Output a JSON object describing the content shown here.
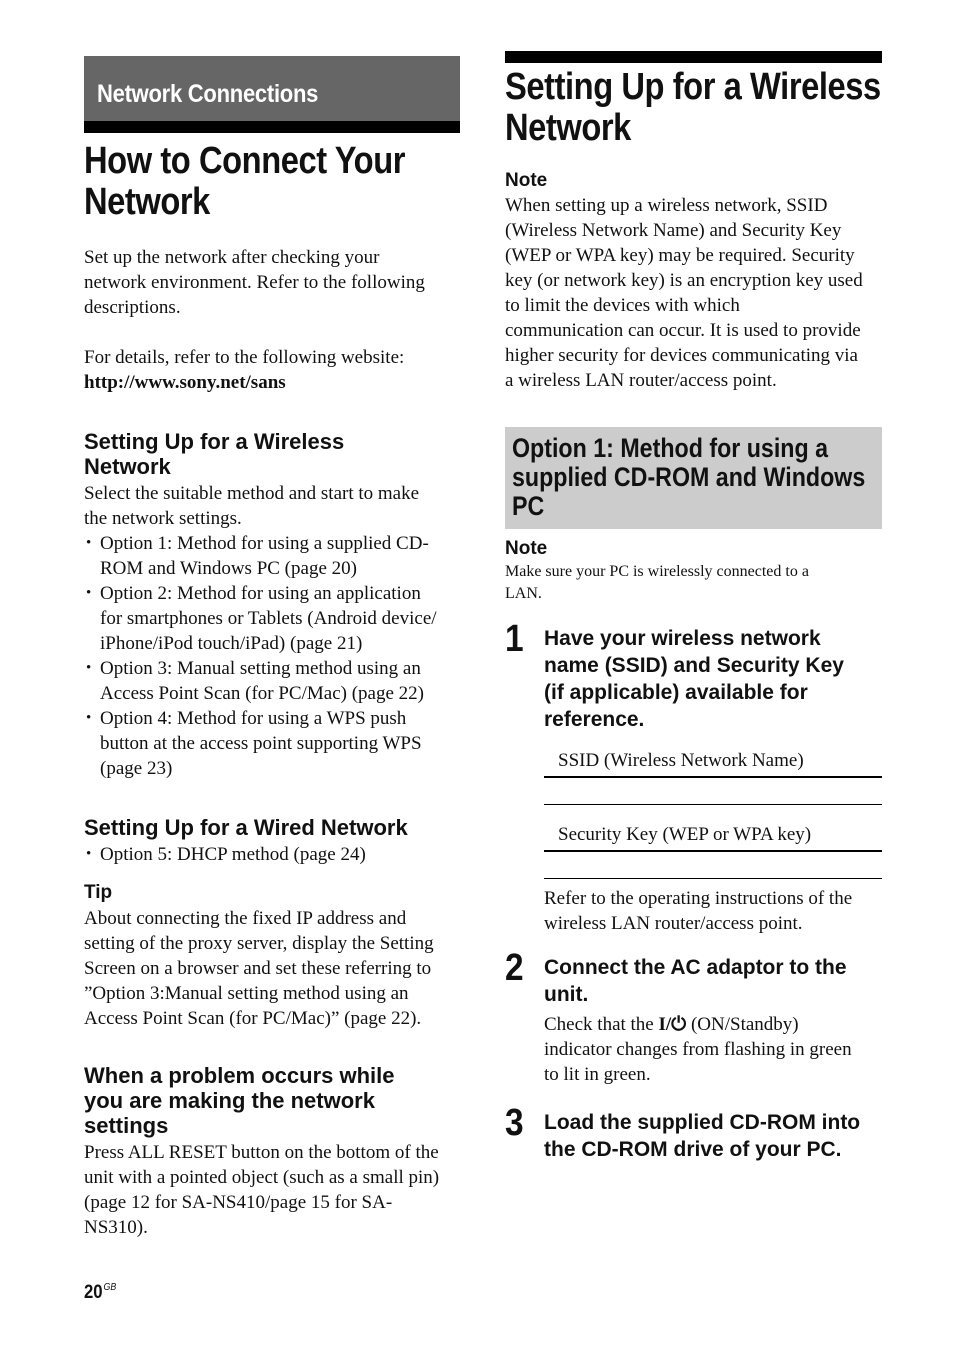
{
  "left": {
    "section_label": "Network Connections",
    "title_lines": [
      "How to Connect Your",
      "Network"
    ],
    "intro": [
      "Set up the network after checking your",
      "network environment. Refer to the following",
      "descriptions."
    ],
    "details_text": "For details, refer to the following website:",
    "website_link": "http://www.sony.net/sans",
    "wireless": {
      "heading_lines": [
        "Setting Up for a Wireless",
        "Network"
      ],
      "intro_lines": [
        "Select the suitable method and start to make",
        "the network settings."
      ],
      "options": [
        {
          "lines": [
            "Option 1: Method for using a supplied CD-",
            "ROM and Windows PC (page 20)"
          ]
        },
        {
          "lines": [
            "Option 2: Method for using an application",
            "for smartphones or Tablets (Android device/",
            "iPhone/iPod touch/iPad) (page 21)"
          ]
        },
        {
          "lines": [
            "Option 3: Manual setting method using an",
            "Access Point Scan (for PC/Mac) (page 22)"
          ]
        },
        {
          "lines": [
            "Option 4: Method for using a WPS push",
            "button at the access point supporting WPS",
            "(page 23)"
          ]
        }
      ]
    },
    "wired": {
      "heading": "Setting Up for a Wired Network",
      "options": [
        "Option 5: DHCP method (page 24)"
      ]
    },
    "tip": {
      "label": "Tip",
      "lines": [
        "About connecting the fixed IP address and",
        "setting of the proxy server, display the Setting",
        "Screen on a browser and set these referring to",
        "”Option 3:Manual setting method using an",
        "Access Point Scan (for PC/Mac)” (page 22)."
      ]
    },
    "problem": {
      "heading_lines": [
        "When a problem occurs while",
        "you are making the network",
        "settings"
      ],
      "lines": [
        "Press ALL RESET button on the bottom of the",
        "unit with a pointed object (such as a small pin)",
        "(page 12 for SA-NS410/page 15 for SA-",
        "NS310)."
      ]
    }
  },
  "right": {
    "title_lines": [
      "Setting Up for a Wireless",
      "Network"
    ],
    "note": {
      "label": "Note",
      "lines": [
        "When setting up a wireless network, SSID",
        "(Wireless Network Name) and Security Key",
        "(WEP or WPA key) may be required. Security",
        "key (or network key) is an encryption key used",
        "to limit the devices with which",
        "communication can occur. It is used to provide",
        "higher security for devices communicating via",
        "a wireless LAN router/access point."
      ]
    },
    "option_box_lines": [
      "Option 1: Method for using a",
      "supplied CD-ROM and Windows",
      "PC"
    ],
    "note2": {
      "label": "Note",
      "lines": [
        "Make sure your PC is wirelessly connected to a",
        "LAN."
      ]
    },
    "steps": [
      {
        "number": "1",
        "title_lines": [
          "Have your wireless network",
          "name (SSID) and Security Key",
          "(if applicable) available for",
          "reference."
        ],
        "fields": [
          {
            "label": "SSID (Wireless Network Name)",
            "value": ""
          },
          {
            "label": "Security Key (WEP or WPA key)",
            "value": ""
          }
        ],
        "body_lines": [
          "Refer to the operating instructions of the",
          "wireless LAN router/access point."
        ]
      },
      {
        "number": "2",
        "title_lines": [
          "Connect the AC adaptor to the",
          "unit."
        ],
        "body_prefix": "Check that the ",
        "power_symbol": "I/⏻",
        "body_suffix": " (ON/Standby)",
        "body_lines": [
          "indicator changes from flashing in green",
          "to lit in green."
        ]
      },
      {
        "number": "3",
        "title_lines": [
          "Load the supplied CD-ROM into",
          "the CD-ROM drive of your PC."
        ]
      }
    ]
  },
  "footer": {
    "page_number": "20",
    "page_suffix": "GB"
  }
}
